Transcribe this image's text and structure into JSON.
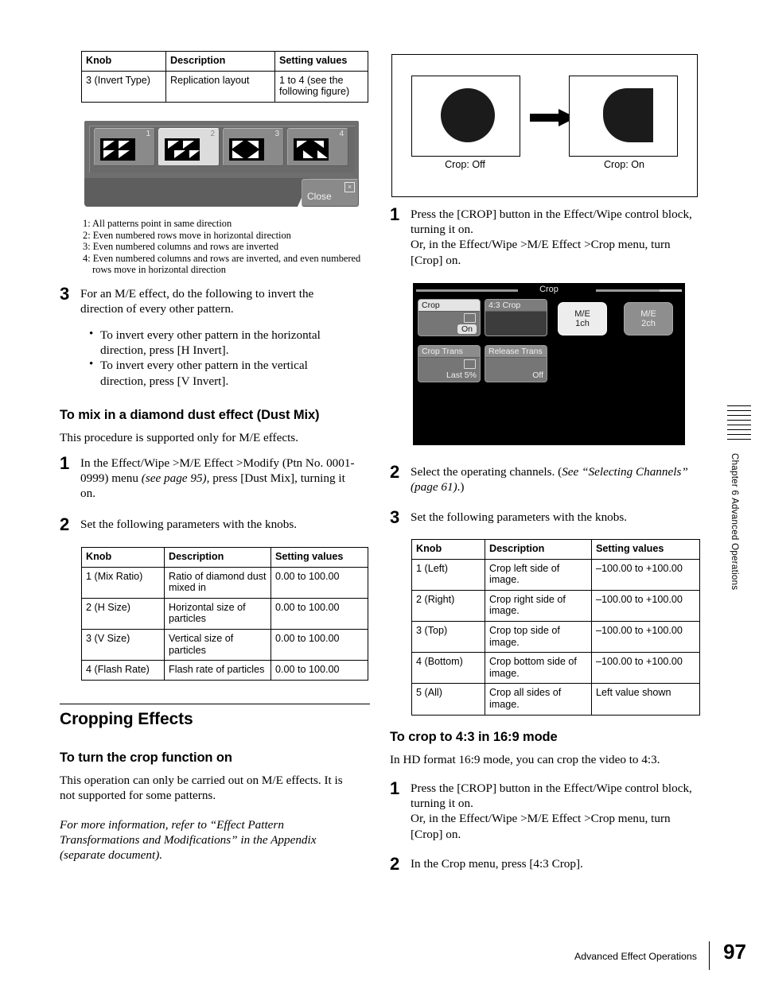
{
  "invert_table": {
    "headers": [
      "Knob",
      "Description",
      "Setting values"
    ],
    "rows": [
      [
        "3 (Invert Type)",
        "Replication layout",
        "1 to 4 (see the following figure)"
      ]
    ]
  },
  "invert_panel": {
    "buttons": [
      {
        "number": "1",
        "selected": false
      },
      {
        "number": "2",
        "selected": true
      },
      {
        "number": "3",
        "selected": false
      },
      {
        "number": "4",
        "selected": false
      }
    ],
    "close_label": "Close",
    "close_icon": "close-box-icon"
  },
  "invert_captions": [
    "1: All patterns point in same direction",
    "2: Even numbered rows move in horizontal direction",
    "3: Even numbered columns and rows are inverted",
    "4: Even numbered columns and rows are inverted, and even numbered",
    "rows move in horizontal direction"
  ],
  "step3_invert": {
    "number": "3",
    "text": "For an M/E effect, do the following to invert the direction of every other pattern.",
    "bullets": [
      "To invert every other pattern in the horizontal direction, press [H Invert].",
      "To invert every other pattern in the vertical direction, press [V Invert]."
    ]
  },
  "dustmix": {
    "heading": "To mix in a diamond dust effect (Dust Mix)",
    "intro": "This procedure is supported only for M/E effects.",
    "step1": {
      "number": "1",
      "part1": "In the Effect/Wipe >M/E Effect >Modify (Ptn No. 0001-0999) menu ",
      "italic": "(see page 95)",
      "part2": ", press [Dust Mix], turning it on."
    },
    "step2": {
      "number": "2",
      "text": "Set the following parameters with the knobs."
    },
    "table": {
      "headers": [
        "Knob",
        "Description",
        "Setting values"
      ],
      "rows": [
        [
          "1 (Mix Ratio)",
          "Ratio of diamond dust mixed in",
          "0.00 to 100.00"
        ],
        [
          "2 (H Size)",
          "Horizontal size of particles",
          "0.00 to 100.00"
        ],
        [
          "3 (V Size)",
          "Vertical size of particles",
          "0.00 to 100.00"
        ],
        [
          "4 (Flash Rate)",
          "Flash rate of particles",
          "0.00 to 100.00"
        ]
      ]
    }
  },
  "cropping": {
    "section_heading": "Cropping Effects",
    "sub_heading": "To turn the crop function on",
    "para1": "This operation can only be carried out on M/E effects. It is not supported for some patterns.",
    "para2_italic": "For more information, refer to “Effect Pattern Transformations and Modifications” in the Appendix (separate document)."
  },
  "crop_figure": {
    "left_label": "Crop: Off",
    "right_label": "Crop: On",
    "arrow_icon": "right-arrow-icon"
  },
  "crop_steps": {
    "step1": {
      "number": "1",
      "line1": "Press the [CROP] button in the Effect/Wipe control block, turning it on.",
      "line2": "Or, in the Effect/Wipe >M/E Effect >Crop menu, turn [Crop] on."
    },
    "step2": {
      "number": "2",
      "part1": "Select the operating channels. (",
      "italic": "See “Selecting Channels” (page 61)",
      "part2": ".)"
    },
    "step3": {
      "number": "3",
      "text": "Set the following parameters with the knobs."
    }
  },
  "crop_menu": {
    "title": "Crop",
    "buttons": [
      {
        "label": "Crop",
        "value": "On",
        "highlighted": true,
        "icon": "crop-box-icon",
        "value_boxed": true
      },
      {
        "label": "4:3 Crop",
        "value": "",
        "highlighted": false,
        "dark": true,
        "icon": "",
        "value_boxed": false
      },
      {
        "label": "Crop Trans",
        "value": "Last 5%",
        "highlighted": false,
        "icon": "transition-icon",
        "value_boxed": false
      },
      {
        "label": "Release Trans",
        "value": "Off",
        "highlighted": false,
        "icon": "",
        "value_boxed": false
      }
    ],
    "channels": [
      {
        "line1": "M/E",
        "line2": "1ch",
        "selected": true
      },
      {
        "line1": "M/E",
        "line2": "2ch",
        "selected": false
      }
    ]
  },
  "crop_table": {
    "headers": [
      "Knob",
      "Description",
      "Setting values"
    ],
    "rows": [
      [
        "1 (Left)",
        "Crop left side of image.",
        "–100.00 to +100.00"
      ],
      [
        "2 (Right)",
        "Crop right side of image.",
        "–100.00 to +100.00"
      ],
      [
        "3 (Top)",
        "Crop top side of image.",
        "–100.00 to +100.00"
      ],
      [
        "4 (Bottom)",
        "Crop bottom side of image.",
        "–100.00 to +100.00"
      ],
      [
        "5 (All)",
        "Crop all sides of image.",
        "Left value shown"
      ]
    ]
  },
  "crop43": {
    "heading": "To crop to 4:3 in 16:9 mode",
    "intro": "In HD format 16:9 mode, you can crop the video to 4:3.",
    "step1": {
      "number": "1",
      "line1": "Press the [CROP] button in the Effect/Wipe control block, turning it on.",
      "line2": "Or, in the Effect/Wipe >M/E Effect >Crop menu, turn [Crop] on."
    },
    "step2": {
      "number": "2",
      "text": "In the Crop menu, press [4:3 Crop]."
    }
  },
  "sidetab": {
    "text": "Chapter 6   Advanced Operations"
  },
  "footer": {
    "text": "Advanced Effect Operations",
    "page": "97"
  }
}
